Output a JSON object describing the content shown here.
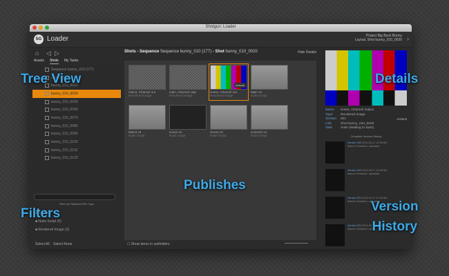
{
  "window": {
    "title": "Shotgun: Loader"
  },
  "header": {
    "app_title": "Loader",
    "logo_text": "SG",
    "project_line1": "Project Big Buck Bunny",
    "project_line2": "Layout, Shot bunny_010_0020"
  },
  "left": {
    "tabs": [
      "Assets",
      "Shots",
      "My Tasks"
    ],
    "tree": [
      {
        "label": "Sequence bunny_010 (177)",
        "sel": false
      },
      {
        "label": "shot (1-162)",
        "sel": false
      },
      {
        "label": "bunny_010_0010",
        "sel": false
      },
      {
        "label": "bunny_010_0020",
        "sel": true
      },
      {
        "label": "bunny_010_0030",
        "sel": false
      },
      {
        "label": "bunny_010_0040",
        "sel": false
      },
      {
        "label": "bunny_010_0070",
        "sel": false
      },
      {
        "label": "bunny_010_0080",
        "sel": false
      },
      {
        "label": "bunny_010_0090",
        "sel": false
      },
      {
        "label": "bunny_010_0100",
        "sel": false
      },
      {
        "label": "bunny_010_0110",
        "sel": false
      },
      {
        "label": "bunny_010_0120",
        "sel": false
      }
    ],
    "filter_title": "Filter by Published File Type",
    "filters": [
      "Folders",
      "Nuke Script (5)",
      "Rendered Image (3)"
    ],
    "select_all": "Select All",
    "select_none": "Select None"
  },
  "center": {
    "breadcrumb": {
      "a": "Shots",
      "b": "Sequence",
      "c": "Sequence bunny_010 (177)",
      "d": "Shot",
      "e": "bunny_010_0020"
    },
    "hide_details": "Hide Details",
    "cards": [
      {
        "name": "main3, Channel out",
        "type": "Rendered Image",
        "thumb": "checker"
      },
      {
        "name": "main, Channel outp",
        "type": "Rendered Image",
        "thumb": "checker"
      },
      {
        "name": "scene, Channel out",
        "type": "Rendered Image",
        "thumb": "bars",
        "sel": true
      },
      {
        "name": "Main v3",
        "type": "Nuke Script",
        "thumb": "gray"
      },
      {
        "name": "Main3 v3",
        "type": "Nuke Script",
        "thumb": "gray"
      },
      {
        "name": "scene v3",
        "type": "Nuke Script",
        "thumb": "dark"
      },
      {
        "name": "Scene v3",
        "type": "Nuke Script",
        "thumb": "gray"
      },
      {
        "name": "scene22 v3",
        "type": "Nuke Script",
        "thumb": "gray"
      }
    ],
    "actions_label": "Actions",
    "show_subfolders": "Show items in subfolders"
  },
  "right": {
    "details": [
      {
        "k": "Name",
        "v": "scene, Channel output"
      },
      {
        "k": "Type",
        "v": "Rendered Image"
      },
      {
        "k": "Version",
        "v": "001"
      },
      {
        "k": "Link",
        "v": "Shot bunny_010_0020"
      },
      {
        "k": "Task",
        "v": "Anim (Waiting to Start)"
      }
    ],
    "actions_label": "Actions",
    "history_title": "Complete Version History",
    "history": [
      {
        "name": "Version 003",
        "date": "2014-03-17 11:58 AM",
        "who": "Manne Öhrström: uploaded"
      },
      {
        "name": "Version 002",
        "date": "2014-03-17 11:55 AM",
        "who": "Manne Öhrström: uploaded"
      },
      {
        "name": "Version 001",
        "date": "2014-03-17 11:50 AM",
        "who": "Manne Öhrström: uploaded"
      },
      {
        "name": "Version 001",
        "date": "2014-03-17 11:48 AM",
        "who": "Manne Öhrström: abc"
      }
    ]
  },
  "overlay_labels": {
    "tree_view": "Tree View",
    "details": "Details",
    "publishes": "Publishes",
    "filters": "Filters",
    "version": "Version",
    "history": "History"
  },
  "colors": {
    "accent": "#e8890c",
    "label": "#3ea9e8"
  }
}
